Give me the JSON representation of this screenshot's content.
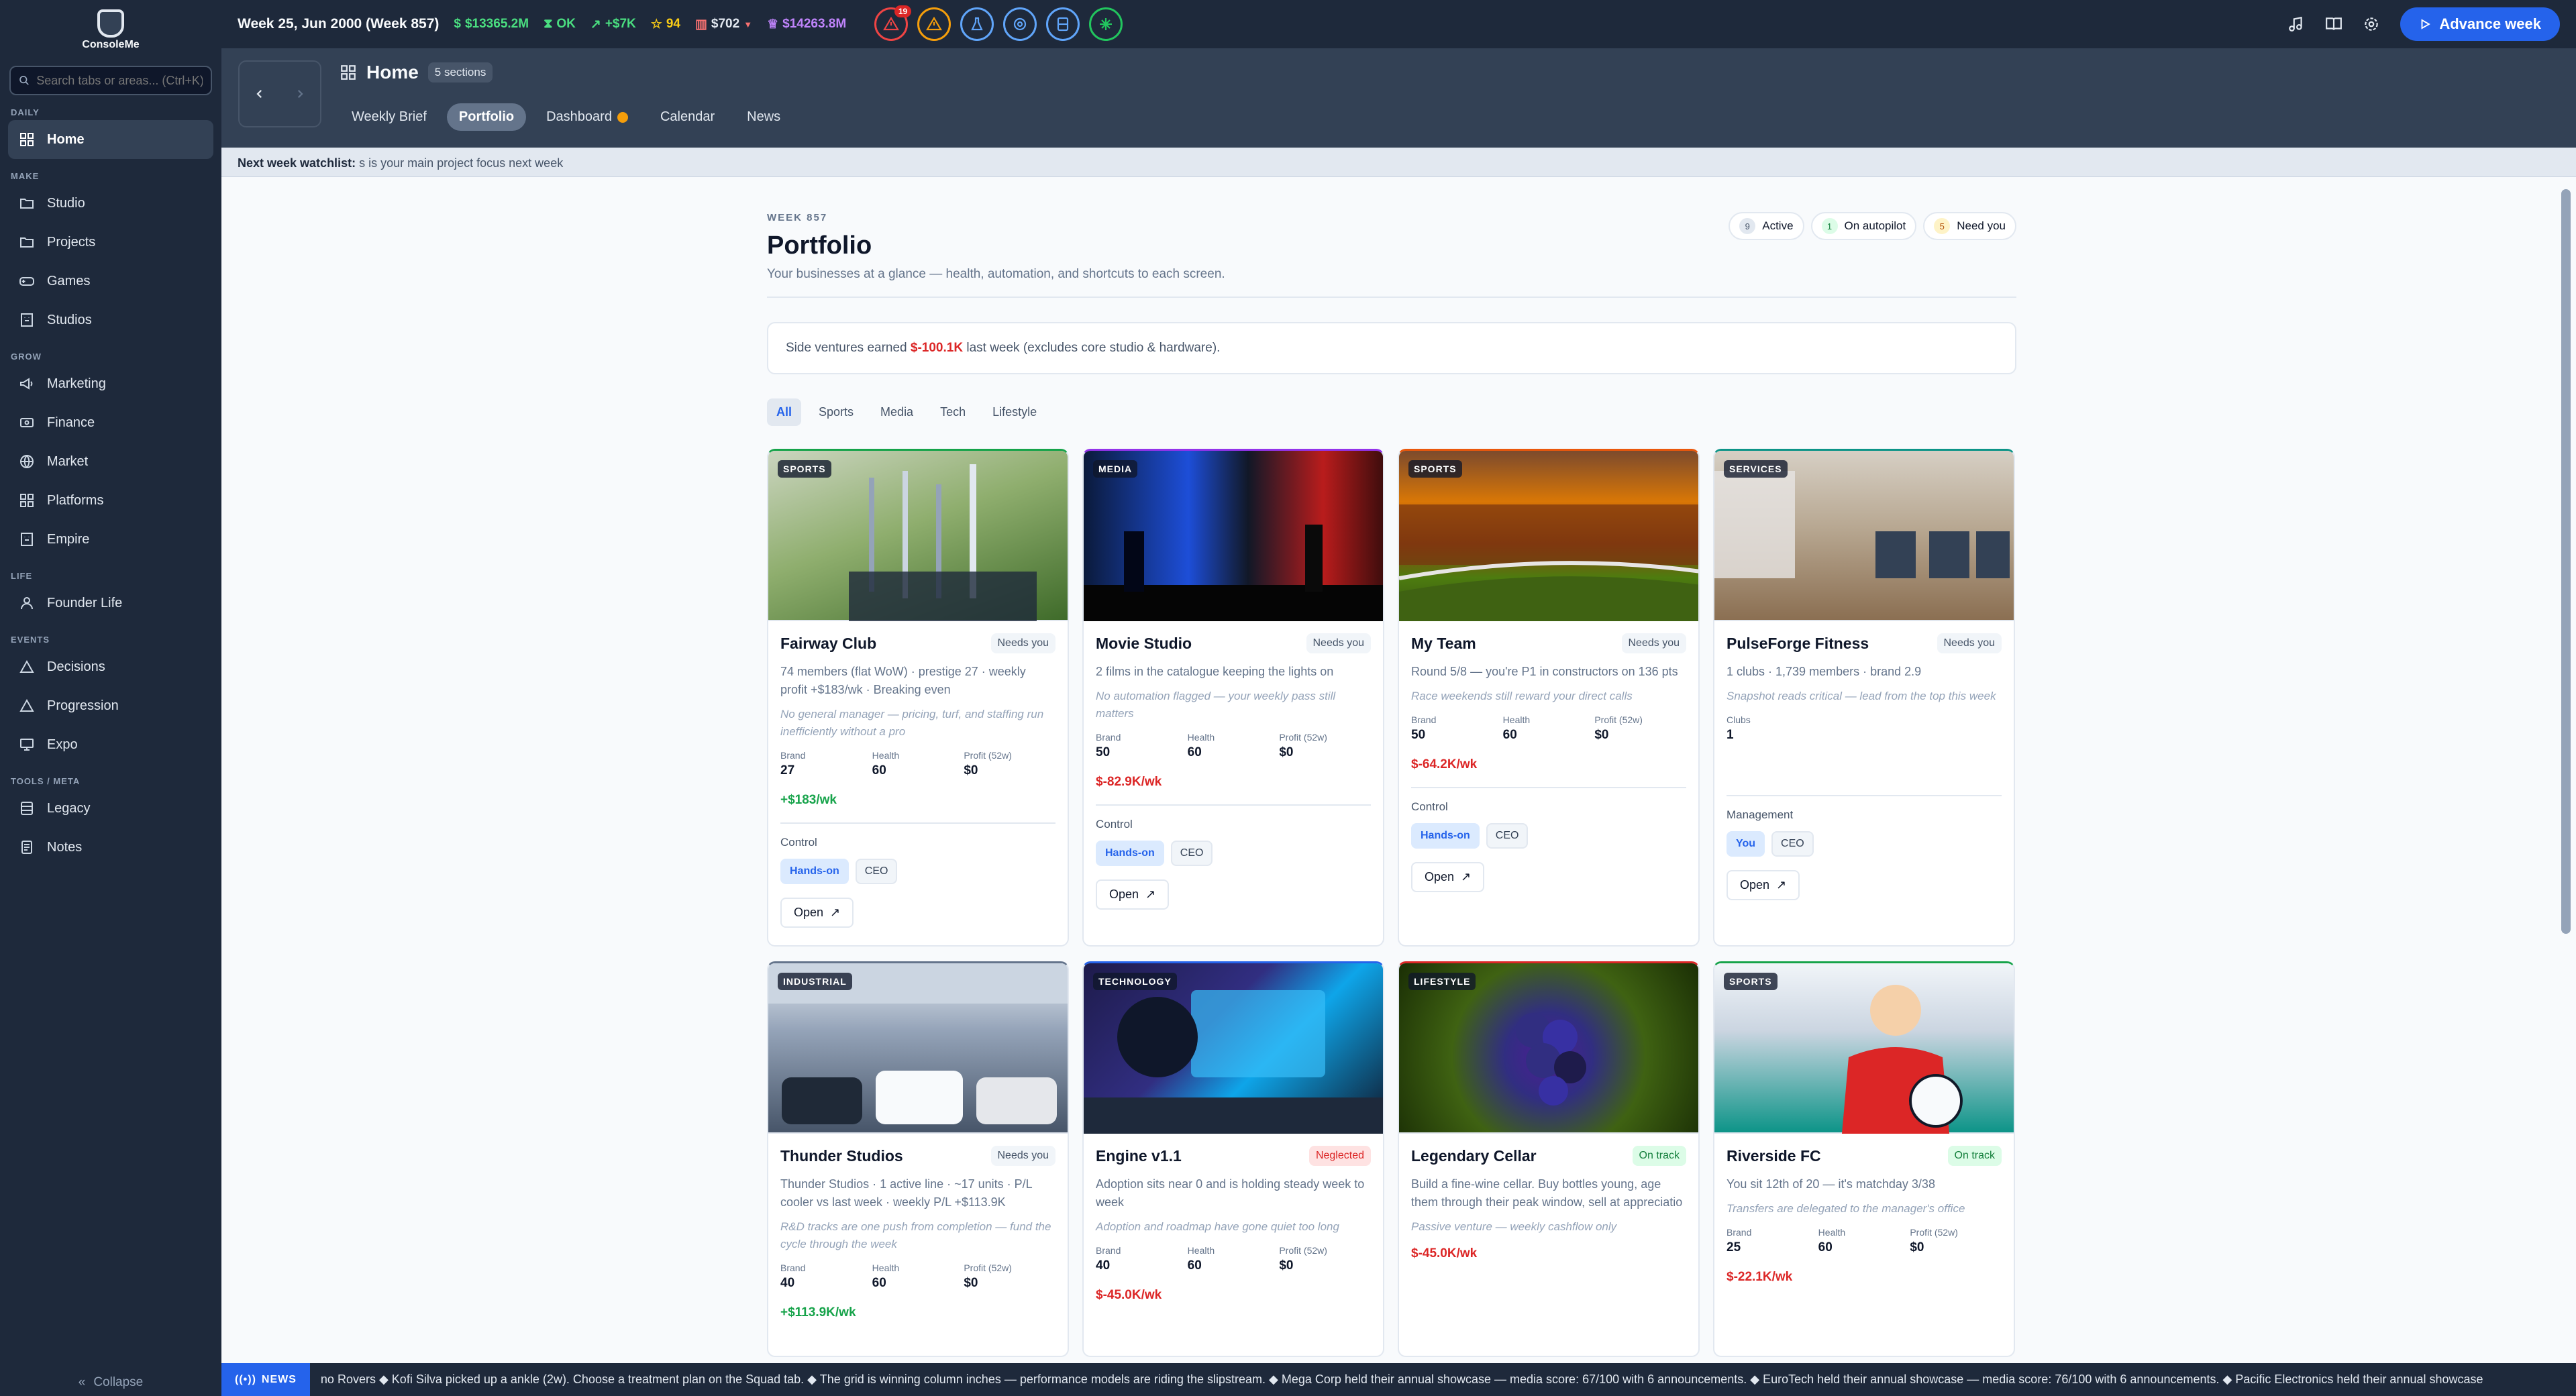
{
  "app": {
    "logo_text": "ConsoleMe",
    "search_placeholder": "Search tabs or areas... (Ctrl+K)",
    "collapse": "Collapse"
  },
  "sidebar": {
    "sections": [
      {
        "title": "DAILY",
        "items": [
          {
            "label": "Home",
            "icon": "grid-icon",
            "active": true
          }
        ]
      },
      {
        "title": "MAKE",
        "items": [
          {
            "label": "Studio",
            "icon": "folder-icon"
          },
          {
            "label": "Projects",
            "icon": "folder-icon"
          },
          {
            "label": "Games",
            "icon": "gamepad-icon"
          },
          {
            "label": "Studios",
            "icon": "building-icon"
          }
        ]
      },
      {
        "title": "GROW",
        "items": [
          {
            "label": "Marketing",
            "icon": "megaphone-icon"
          },
          {
            "label": "Finance",
            "icon": "finance-icon"
          },
          {
            "label": "Market",
            "icon": "globe-icon"
          },
          {
            "label": "Platforms",
            "icon": "grid-icon"
          },
          {
            "label": "Empire",
            "icon": "building-icon"
          }
        ]
      },
      {
        "title": "LIFE",
        "items": [
          {
            "label": "Founder Life",
            "icon": "person-icon"
          }
        ]
      },
      {
        "title": "EVENTS",
        "items": [
          {
            "label": "Decisions",
            "icon": "triangle-icon"
          },
          {
            "label": "Progression",
            "icon": "triangle-icon"
          },
          {
            "label": "Expo",
            "icon": "monitor-icon"
          }
        ]
      },
      {
        "title": "TOOLS / META",
        "items": [
          {
            "label": "Legacy",
            "icon": "archive-icon"
          },
          {
            "label": "Notes",
            "icon": "note-icon"
          }
        ]
      }
    ]
  },
  "topbar": {
    "week": "Week 25, Jun 2000 (Week 857)",
    "cash": "$13365.2M",
    "status": "OK",
    "trend": "+$7K",
    "stars": "94",
    "price": "$702",
    "valuation": "$14263.8M",
    "alert_count": "19",
    "advance": "Advance week",
    "colors": {
      "cash": "#4ade80",
      "ok": "#4ade80",
      "stars": "#facc15",
      "price": "#e2e8f0",
      "valuation": "#c084fc"
    }
  },
  "header": {
    "title": "Home",
    "sections_pill": "5 sections",
    "tabs": [
      "Weekly Brief",
      "Portfolio",
      "Dashboard",
      "Calendar",
      "News"
    ],
    "active_tab": "Portfolio"
  },
  "watchlist": {
    "label": "Next week watchlist:",
    "text": "s is your main project focus next week"
  },
  "portfolio": {
    "eyebrow": "WEEK 857",
    "title": "Portfolio",
    "subtitle": "Your businesses at a glance — health, automation, and shortcuts to each screen.",
    "chips": [
      {
        "n": "9",
        "label": "Active"
      },
      {
        "n": "1",
        "label": "On autopilot"
      },
      {
        "n": "5",
        "label": "Need you"
      }
    ],
    "banner": {
      "pre": "Side ventures earned",
      "amount": "$-100.1K",
      "post": "last week (excludes core studio & hardware)."
    },
    "filters": [
      "All",
      "Sports",
      "Media",
      "Tech",
      "Lifestyle"
    ],
    "labels": {
      "brand": "Brand",
      "health": "Health",
      "profit": "Profit (52w)",
      "open": "Open"
    },
    "cards": [
      {
        "cat": "SPORTS",
        "title": "Fairway Club",
        "status": "Needs you",
        "desc": "74 members (flat WoW) · prestige 27 · weekly profit +$183/wk · Breaking even",
        "note": "No general manager — pricing, turf, and staffing run inefficiently without a pro",
        "brand": "27",
        "health": "60",
        "profit": "$0",
        "weekly": "+$183/wk",
        "control_label": "Control",
        "b1": "Hands-on",
        "b2": "CEO"
      },
      {
        "cat": "MEDIA",
        "title": "Movie Studio",
        "status": "Needs you",
        "desc": "2 films in the catalogue keeping the lights on",
        "note": "No automation flagged — your weekly pass still matters",
        "brand": "50",
        "health": "60",
        "profit": "$0",
        "weekly": "$-82.9K/wk",
        "control_label": "Control",
        "b1": "Hands-on",
        "b2": "CEO"
      },
      {
        "cat": "SPORTS",
        "title": "My Team",
        "status": "Needs you",
        "desc": "Round 5/8 — you're P1 in constructors on 136 pts",
        "note": "Race weekends still reward your direct calls",
        "brand": "50",
        "health": "60",
        "profit": "$0",
        "weekly": "$-64.2K/wk",
        "control_label": "Control",
        "b1": "Hands-on",
        "b2": "CEO"
      },
      {
        "cat": "SERVICES",
        "title": "PulseForge Fitness",
        "status": "Needs you",
        "desc": "1 clubs · 1,739 members · brand 2.9",
        "note": "Snapshot reads critical — lead from the top this week",
        "clubs_label": "Clubs",
        "clubs": "1",
        "control_label": "Management",
        "b1": "You",
        "b2": "CEO"
      },
      {
        "cat": "INDUSTRIAL",
        "title": "Thunder Studios",
        "status": "Needs you",
        "desc": "Thunder Studios · 1 active line · ~17 units · P/L cooler vs last week · weekly P/L +$113.9K",
        "note": "R&D tracks are one push from completion — fund the cycle through the week",
        "brand": "40",
        "health": "60",
        "profit": "$0",
        "weekly": "+$113.9K/wk"
      },
      {
        "cat": "TECHNOLOGY",
        "title": "Engine v1.1",
        "status": "Neglected",
        "desc": "Adoption sits near 0 and is holding steady week to week",
        "note": "Adoption and roadmap have gone quiet too long",
        "brand": "40",
        "health": "60",
        "profit": "$0",
        "weekly": "$-45.0K/wk"
      },
      {
        "cat": "LIFESTYLE",
        "title": "Legendary Cellar",
        "status": "On track",
        "desc": "Build a fine-wine cellar. Buy bottles young, age them through their peak window, sell at appreciatio",
        "note": "Passive venture — weekly cashflow only",
        "weekly": "$-45.0K/wk"
      },
      {
        "cat": "SPORTS",
        "title": "Riverside FC",
        "status": "On track",
        "desc": "You sit 12th of 20 — it's matchday 3/38",
        "note": "Transfers are delegated to the manager's office",
        "brand": "25",
        "health": "60",
        "profit": "$0",
        "weekly": "$-22.1K/wk"
      }
    ]
  },
  "ticker": {
    "label": "NEWS",
    "text": "no Rovers ◆ Kofi Silva picked up a ankle (2w). Choose a treatment plan on the Squad tab. ◆ The grid is winning column inches — performance models are riding the slipstream. ◆ Mega Corp held their annual showcase — media score: 67/100 with 6 announcements. ◆ EuroTech held their annual showcase — media score: 76/100 with 6 announcements. ◆ Pacific Electronics held their annual showcase"
  }
}
